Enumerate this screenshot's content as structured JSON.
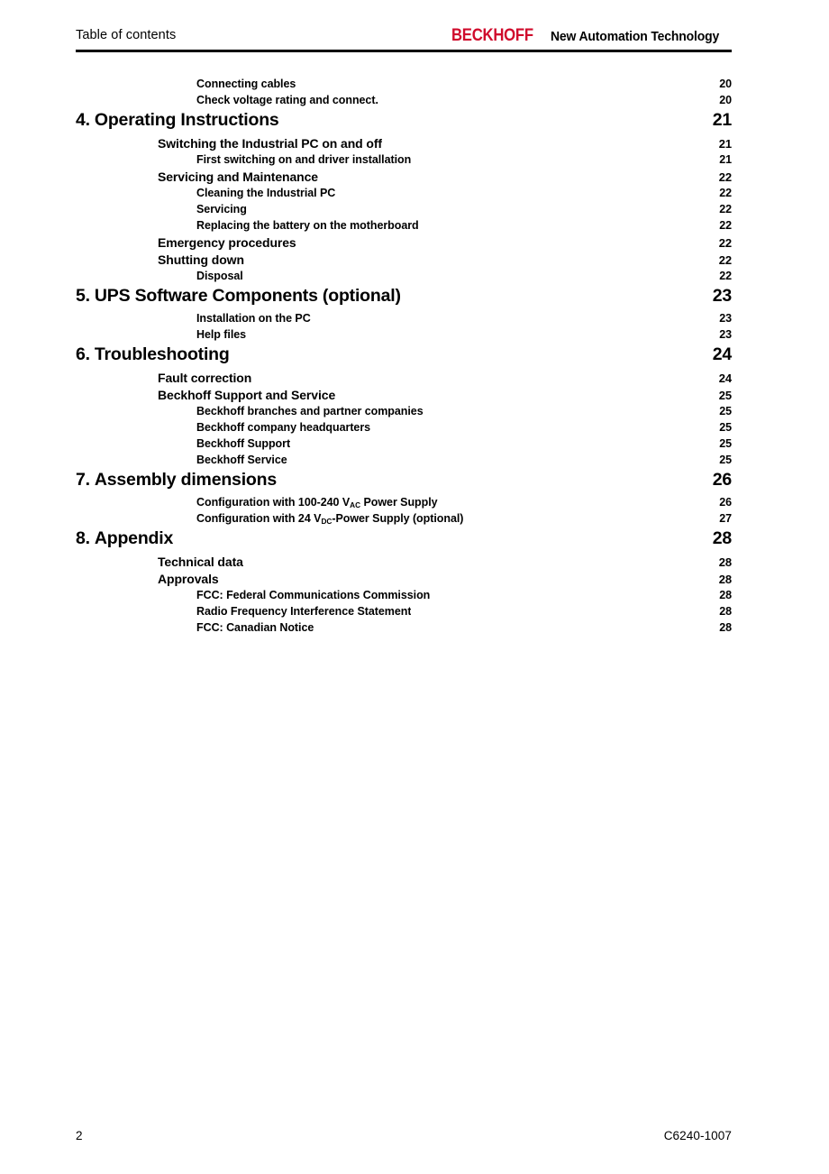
{
  "header": {
    "title": "Table of contents",
    "brand_name": "BECKHOFF",
    "brand_tagline": "New Automation Technology",
    "brand_color": "#D00B2C"
  },
  "toc": {
    "entries": [
      {
        "level": 3,
        "label": "Connecting cables",
        "page": "20"
      },
      {
        "level": 3,
        "label": "Check voltage rating and connect.",
        "page": "20"
      },
      {
        "level": 1,
        "number": "4.",
        "label": "Operating Instructions",
        "page": "21"
      },
      {
        "level": 2,
        "label": "Switching the Industrial PC on and off",
        "page": "21"
      },
      {
        "level": 3,
        "label": "First switching on and driver installation",
        "page": "21"
      },
      {
        "level": 2,
        "label": "Servicing and Maintenance",
        "page": "22"
      },
      {
        "level": 3,
        "label": "Cleaning the Industrial PC",
        "page": "22"
      },
      {
        "level": 3,
        "label": "Servicing",
        "page": "22"
      },
      {
        "level": 3,
        "label": "Replacing the battery on the motherboard",
        "page": "22"
      },
      {
        "level": 2,
        "label": "Emergency procedures",
        "page": "22"
      },
      {
        "level": 2,
        "label": "Shutting down",
        "page": "22"
      },
      {
        "level": 3,
        "label": "Disposal",
        "page": "22"
      },
      {
        "level": 1,
        "number": "5.",
        "label": "UPS Software Components (optional)",
        "page": "23"
      },
      {
        "level": 3,
        "label": "Installation on the PC",
        "page": "23"
      },
      {
        "level": 3,
        "label": "Help files",
        "page": "23"
      },
      {
        "level": 1,
        "number": "6.",
        "label": "Troubleshooting",
        "page": "24"
      },
      {
        "level": 2,
        "label": "Fault correction",
        "page": "24"
      },
      {
        "level": 2,
        "label": "Beckhoff Support and Service",
        "page": "25"
      },
      {
        "level": 3,
        "label": "Beckhoff branches and partner companies",
        "page": "25"
      },
      {
        "level": 3,
        "label": "Beckhoff company headquarters",
        "page": "25"
      },
      {
        "level": 3,
        "label": "Beckhoff Support",
        "page": "25"
      },
      {
        "level": 3,
        "label": "Beckhoff Service",
        "page": "25"
      },
      {
        "level": 1,
        "number": "7.",
        "label": "Assembly dimensions",
        "page": "26"
      },
      {
        "level": 3,
        "label_html": "Configuration with 100-240 V<sub>AC</sub> Power Supply",
        "label": "Configuration with 100-240 VAC Power Supply",
        "page": "26"
      },
      {
        "level": 3,
        "label_html": "Configuration with 24 V<sub>DC</sub>-Power Supply (optional)",
        "label": "Configuration with 24 VDC-Power Supply (optional)",
        "page": "27"
      },
      {
        "level": 1,
        "number": "8.",
        "label": "Appendix",
        "page": "28"
      },
      {
        "level": 2,
        "label": "Technical data",
        "page": "28"
      },
      {
        "level": 2,
        "label": "Approvals",
        "page": "28"
      },
      {
        "level": 3,
        "label": "FCC: Federal Communications Commission",
        "page": "28"
      },
      {
        "level": 3,
        "label": "Radio Frequency Interference Statement",
        "page": "28"
      },
      {
        "level": 3,
        "label": "FCC: Canadian Notice",
        "page": "28"
      }
    ]
  },
  "footer": {
    "page_number": "2",
    "document_code": "C6240-1007"
  }
}
